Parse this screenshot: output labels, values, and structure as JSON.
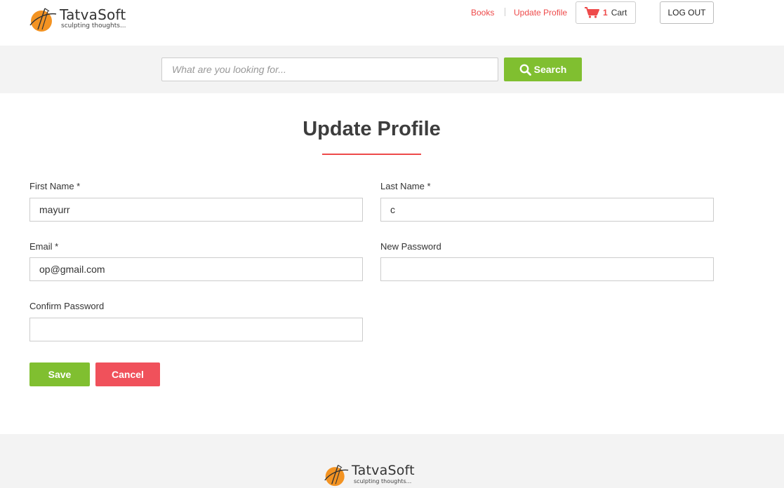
{
  "brand": {
    "name": "TatvaSoft",
    "tagline": "sculpting thoughts..."
  },
  "nav": {
    "books": "Books",
    "update_profile": "Update Profile",
    "cart_count": "1",
    "cart_label": "Cart",
    "logout": "LOG OUT"
  },
  "search": {
    "placeholder": "What are you looking for...",
    "value": "",
    "button_label": "Search"
  },
  "form": {
    "title": "Update Profile",
    "first_name": {
      "label": "First Name *",
      "value": "mayurr"
    },
    "last_name": {
      "label": "Last Name *",
      "value": "c"
    },
    "email": {
      "label": "Email *",
      "value": "op@gmail.com"
    },
    "new_password": {
      "label": "New Password",
      "value": ""
    },
    "confirm_password": {
      "label": "Confirm Password",
      "value": ""
    },
    "save_label": "Save",
    "cancel_label": "Cancel"
  },
  "icons": {
    "cart": "cart-icon",
    "search": "search-icon",
    "logo": "tatvasoft-logo-icon"
  },
  "colors": {
    "accent_red": "#ee4a4a",
    "accent_green": "#80bf30",
    "cancel_red": "#f0515b",
    "band_gray": "#f3f3f3",
    "logo_orange": "#f39322"
  }
}
